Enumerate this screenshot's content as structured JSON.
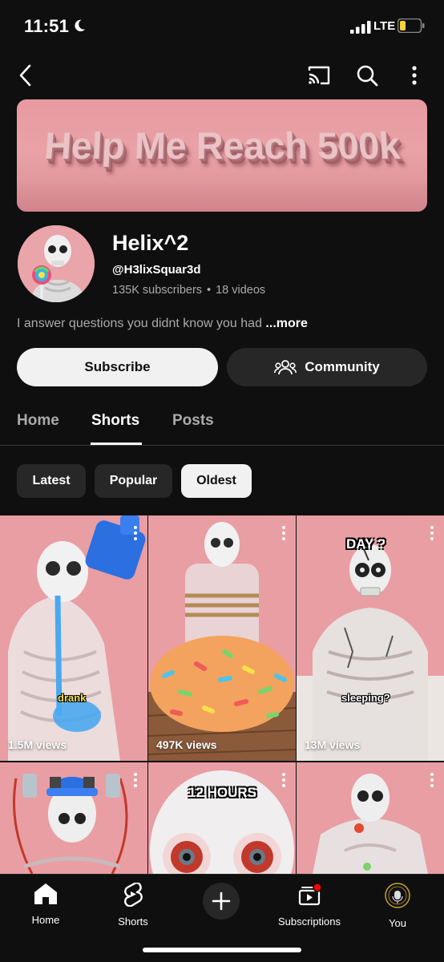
{
  "status_bar": {
    "time": "11:51",
    "network": "LTE",
    "battery_level": 0.25
  },
  "header": {
    "back_icon": "chevron-left-icon",
    "cast_icon": "cast-icon",
    "search_icon": "search-icon",
    "more_icon": "more-vertical-icon"
  },
  "banner": {
    "text": "Help Me Reach 500k"
  },
  "channel": {
    "name": "Helix^2",
    "handle": "@H3lixSquar3d",
    "subscribers": "135K subscribers",
    "separator": "•",
    "videos": "18 videos",
    "description": "I answer questions you didnt know you had",
    "more_label": "...more"
  },
  "actions": {
    "subscribe_label": "Subscribe",
    "community_label": "Community"
  },
  "tabs": [
    {
      "label": "Home",
      "active": false
    },
    {
      "label": "Shorts",
      "active": true
    },
    {
      "label": "Posts",
      "active": false
    }
  ],
  "chips": [
    {
      "label": "Latest",
      "selected": false
    },
    {
      "label": "Popular",
      "selected": false
    },
    {
      "label": "Oldest",
      "selected": true
    }
  ],
  "shorts": [
    {
      "views": "1.5M views",
      "caption": "drank"
    },
    {
      "views": "497K views",
      "caption": ""
    },
    {
      "views": "13M views",
      "caption_top": "DAY ?",
      "caption": "sleeping?"
    },
    {
      "views": "",
      "caption": ""
    },
    {
      "views": "",
      "caption_top": "12 HOURS",
      "caption": ""
    },
    {
      "views": "",
      "caption": ""
    }
  ],
  "bottom_nav": [
    {
      "label": "Home",
      "icon": "home-icon"
    },
    {
      "label": "Shorts",
      "icon": "shorts-icon"
    },
    {
      "label": "",
      "icon": "create-plus-icon"
    },
    {
      "label": "Subscriptions",
      "icon": "subscriptions-icon"
    },
    {
      "label": "You",
      "icon": "avatar"
    }
  ],
  "colors": {
    "background": "#0f0f0f",
    "chip_bg": "#272727",
    "selected_bg": "#f1f1f1",
    "secondary_text": "#aaaaaa",
    "notification": "#ff0000"
  }
}
